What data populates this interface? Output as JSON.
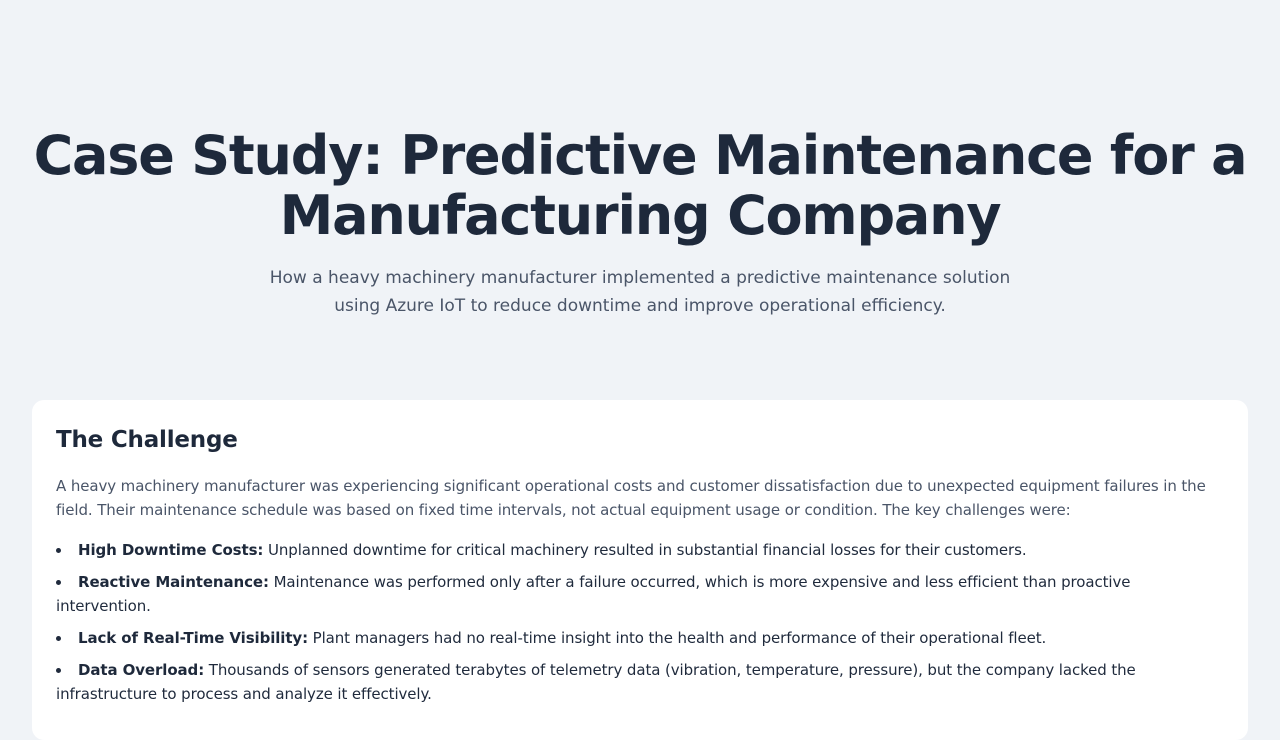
{
  "hero": {
    "title": "Case Study: Predictive Maintenance for a Manufacturing Company",
    "subtitle": "How a heavy machinery manufacturer implemented a predictive maintenance solution using Azure IoT to reduce downtime and improve operational efficiency."
  },
  "challenge": {
    "heading": "The Challenge",
    "intro": "A heavy machinery manufacturer was experiencing significant operational costs and customer dissatisfaction due to unexpected equipment failures in the field. Their maintenance schedule was based on fixed time intervals, not actual equipment usage or condition. The key challenges were:",
    "items": [
      {
        "title": "High Downtime Costs:",
        "text": "Unplanned downtime for critical machinery resulted in substantial financial losses for their customers."
      },
      {
        "title": "Reactive Maintenance:",
        "text": "Maintenance was performed only after a failure occurred, which is more expensive and less efficient than proactive intervention."
      },
      {
        "title": "Lack of Real-Time Visibility:",
        "text": "Plant managers had no real-time insight into the health and performance of their operational fleet."
      },
      {
        "title": "Data Overload:",
        "text": "Thousands of sensors generated terabytes of telemetry data (vibration, temperature, pressure), but the company lacked the infrastructure to process and analyze it effectively."
      }
    ]
  }
}
